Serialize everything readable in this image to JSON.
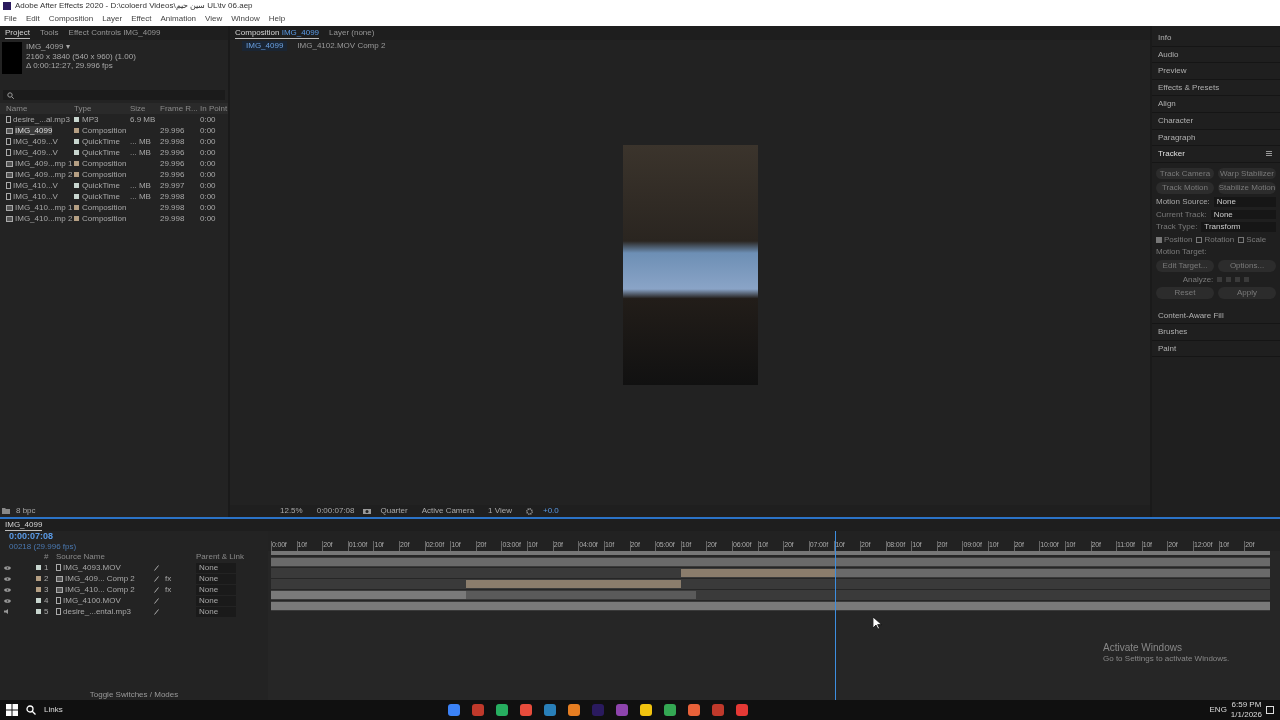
{
  "window": {
    "title": "Adobe After Effects 2020 - D:\\coloerd Videos\\سین حیم UL\\tv 06.aep"
  },
  "menu": [
    "File",
    "Edit",
    "Composition",
    "Layer",
    "Effect",
    "Animation",
    "View",
    "Window",
    "Help"
  ],
  "project_panel": {
    "tabs": [
      {
        "label": "Project",
        "selected": true
      },
      {
        "label": "Tools",
        "selected": false
      },
      {
        "label": "Effect Controls IMG_4099",
        "selected": false
      }
    ],
    "item_name": "IMG_4099 ▾",
    "info": [
      "2160 x 3840  (540 x 960) (1.00)",
      "Δ 0:00:12:27, 29.996 fps"
    ],
    "columns": [
      "Name",
      "Type",
      "Size",
      "Frame R...",
      "In Point"
    ],
    "rows": [
      {
        "name": "desire_...al.mp3",
        "kind": "footage",
        "color": "#c8d6cf",
        "type": "MP3",
        "size": "6.9 MB",
        "fps": "",
        "in_point": "0:00",
        "selected": false
      },
      {
        "name": "IMG_4099",
        "kind": "comp",
        "color": "#b59f83",
        "type": "Composition",
        "size": "",
        "fps": "29.996",
        "in_point": "0:00",
        "selected": true
      },
      {
        "name": "IMG_409...V",
        "kind": "footage",
        "color": "#c8d6cf",
        "type": "QuickTime",
        "size": "... MB",
        "fps": "29.998",
        "in_point": "0:00",
        "selected": false
      },
      {
        "name": "IMG_409...V",
        "kind": "footage",
        "color": "#c8d6cf",
        "type": "QuickTime",
        "size": "... MB",
        "fps": "29.996",
        "in_point": "0:00",
        "selected": false
      },
      {
        "name": "IMG_409...mp 1",
        "kind": "comp",
        "color": "#b59f83",
        "type": "Composition",
        "size": "",
        "fps": "29.996",
        "in_point": "0:00",
        "selected": false
      },
      {
        "name": "IMG_409...mp 2",
        "kind": "comp",
        "color": "#b59f83",
        "type": "Composition",
        "size": "",
        "fps": "29.996",
        "in_point": "0:00",
        "selected": false
      },
      {
        "name": "IMG_410...V",
        "kind": "footage",
        "color": "#c8d6cf",
        "type": "QuickTime",
        "size": "... MB",
        "fps": "29.997",
        "in_point": "0:00",
        "selected": false
      },
      {
        "name": "IMG_410...V",
        "kind": "footage",
        "color": "#c8d6cf",
        "type": "QuickTime",
        "size": "... MB",
        "fps": "29.998",
        "in_point": "0:00",
        "selected": false
      },
      {
        "name": "IMG_410...mp 1",
        "kind": "comp",
        "color": "#b59f83",
        "type": "Composition",
        "size": "",
        "fps": "29.998",
        "in_point": "0:00",
        "selected": false
      },
      {
        "name": "IMG_410...mp 2",
        "kind": "comp",
        "color": "#b59f83",
        "type": "Composition",
        "size": "",
        "fps": "29.998",
        "in_point": "0:00",
        "selected": false
      }
    ],
    "footer": "8 bpc"
  },
  "viewer": {
    "tabs": [
      {
        "label": "Composition",
        "comp": "IMG_4099",
        "selected": true
      },
      {
        "label": "Layer (none)",
        "selected": false
      }
    ],
    "breadcrumbs": [
      "IMG_4099",
      "IMG_4102.MOV Comp 2"
    ],
    "toolbar": {
      "zoom": "12.5%",
      "time": "0:00:07:08",
      "resolution": "Quarter",
      "camera": "Active Camera",
      "views": "1 View",
      "exposure": "+0.0"
    }
  },
  "right_panels": [
    {
      "label": "Info",
      "expanded": false
    },
    {
      "label": "Audio",
      "expanded": false
    },
    {
      "label": "Preview",
      "expanded": false
    },
    {
      "label": "Effects & Presets",
      "expanded": false
    },
    {
      "label": "Align",
      "expanded": false
    },
    {
      "label": "Character",
      "expanded": false
    },
    {
      "label": "Paragraph",
      "expanded": false
    },
    {
      "label": "Tracker",
      "expanded": true,
      "controls": [
        {
          "kind": "buttons",
          "disabled": true,
          "items": [
            "Track Camera",
            "Warp Stabilizer"
          ]
        },
        {
          "kind": "buttons",
          "disabled": true,
          "items": [
            "Track Motion",
            "Stabilize Motion"
          ]
        },
        {
          "kind": "select",
          "disabled": false,
          "label": "Motion Source:",
          "value": "None"
        },
        {
          "kind": "select",
          "disabled": true,
          "label": "Current Track:",
          "value": "None"
        },
        {
          "kind": "select",
          "disabled": true,
          "label": "Track Type:",
          "value": "Transform"
        },
        {
          "kind": "checks",
          "disabled": true,
          "items": [
            {
              "label": "Position",
              "checked": true
            },
            {
              "label": "Rotation",
              "checked": false
            },
            {
              "label": "Scale",
              "checked": false
            }
          ]
        },
        {
          "kind": "text",
          "disabled": true,
          "label": "Motion Target:"
        },
        {
          "kind": "buttons",
          "disabled": true,
          "items": [
            "Edit Target...",
            "Options..."
          ]
        },
        {
          "kind": "analyze",
          "disabled": true,
          "label": "Analyze:"
        },
        {
          "kind": "buttons",
          "disabled": true,
          "items": [
            "Reset",
            "Apply"
          ]
        }
      ]
    },
    {
      "label": "Content-Aware Fill",
      "expanded": false
    },
    {
      "label": "Brushes",
      "expanded": false
    },
    {
      "label": "Paint",
      "expanded": false
    }
  ],
  "timeline": {
    "comp_tab": "IMG_4099",
    "time": "0:00:07:08",
    "frame_info": "00218 (29.996 fps)",
    "columns": [
      "#",
      "Source Name",
      "Parent & Link"
    ],
    "layers": [
      {
        "number": "1",
        "name": "IMG_4093.MOV",
        "kind": "footage",
        "color": "#c8d6cf",
        "visible": true,
        "audio": false,
        "parent": "None"
      },
      {
        "number": "2",
        "name": "IMG_409... Comp 2",
        "kind": "comp",
        "color": "#b59f83",
        "visible": true,
        "audio": false,
        "effects": "fx",
        "parent": "None"
      },
      {
        "number": "3",
        "name": "IMG_410... Comp 2",
        "kind": "comp",
        "color": "#b59f83",
        "visible": true,
        "audio": false,
        "effects": "fx",
        "parent": "None"
      },
      {
        "number": "4",
        "name": "IMG_4100.MOV",
        "kind": "footage",
        "color": "#c8d6cf",
        "visible": true,
        "audio": false,
        "parent": "None"
      },
      {
        "number": "5",
        "name": "desire_...ental.mp3",
        "kind": "audio",
        "color": "#c8d6cf",
        "visible": false,
        "audio": true,
        "parent": "None"
      }
    ],
    "ruler": [
      "0:00f",
      "10f",
      "20f",
      "01:00f",
      "10f",
      "20f",
      "02:00f",
      "10f",
      "20f",
      "03:00f",
      "10f",
      "20f",
      "04:00f",
      "10f",
      "20f",
      "05:00f",
      "10f",
      "20f",
      "06:00f",
      "10f",
      "20f",
      "07:00f",
      "10f",
      "20f",
      "08:00f",
      "10f",
      "20f",
      "09:00f",
      "10f",
      "20f",
      "10:00f",
      "10f",
      "20f",
      "11:00f",
      "10f",
      "20f",
      "12:00f",
      "10f",
      "20f"
    ],
    "playhead": {
      "level": 0.565
    },
    "footer": "Toggle Switches / Modes"
  },
  "activation": {
    "title": "Activate Windows",
    "text": "Go to Settings to activate Windows."
  },
  "taskbar": {
    "search": "Links",
    "language": "ENG",
    "time": "6:59 PM",
    "date": "1/1/2026"
  }
}
